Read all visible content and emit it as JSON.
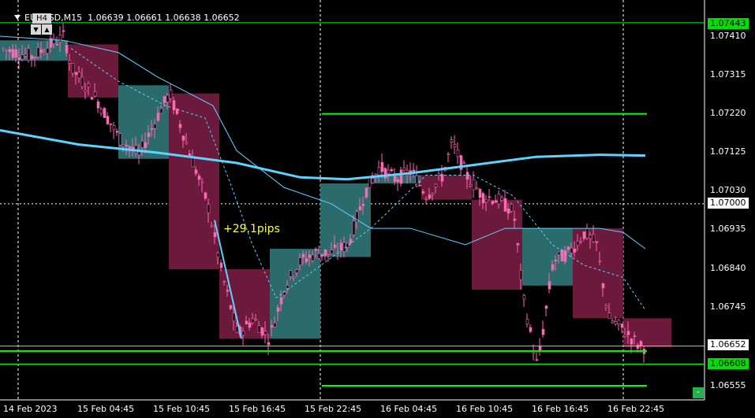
{
  "header": {
    "symbol": "EURUSD,M15",
    "open": "1.06639",
    "high": "1.06661",
    "low": "1.06638",
    "close": "1.06652"
  },
  "timeframe_box": "H4",
  "annotation": "+29.1pips",
  "colors": {
    "bull_candle": "#ff66b3",
    "bear_candle": "#ff66b3",
    "bull_box": "#2b6b6b",
    "bear_box": "#6b1a3c",
    "ma_long": "#5fd3ff",
    "ma_short": "#5fd3ff",
    "level_line": "#00ff00",
    "grid": "#ffffff"
  },
  "price_labels": [
    {
      "text": "1.07443",
      "type": "highlight"
    },
    {
      "text": "1.07410",
      "type": "tick"
    },
    {
      "text": "1.07315",
      "type": "tick"
    },
    {
      "text": "1.07220",
      "type": "tick"
    },
    {
      "text": "1.07125",
      "type": "tick"
    },
    {
      "text": "1.07030",
      "type": "tick"
    },
    {
      "text": "1.07000",
      "type": "crosshair"
    },
    {
      "text": "1.06935",
      "type": "tick"
    },
    {
      "text": "1.06840",
      "type": "tick"
    },
    {
      "text": "1.06745",
      "type": "tick"
    },
    {
      "text": "1.06652",
      "type": "current"
    },
    {
      "text": "1.06608",
      "type": "highlight"
    },
    {
      "text": "1.06555",
      "type": "tick"
    }
  ],
  "time_labels": [
    "14 Feb 2023",
    "15 Feb 04:45",
    "15 Feb 10:45",
    "15 Feb 16:45",
    "15 Feb 22:45",
    "16 Feb 04:45",
    "16 Feb 10:45",
    "16 Feb 16:45",
    "16 Feb 22:45"
  ],
  "chart_data": {
    "type": "candlestick",
    "ylim": [
      1.0651,
      1.0755
    ],
    "h4_boxes": [
      {
        "o": 1.0735,
        "c": 1.074,
        "dir": "up"
      },
      {
        "o": 1.0739,
        "c": 1.0726,
        "dir": "down"
      },
      {
        "o": 1.0711,
        "c": 1.0729,
        "dir": "up"
      },
      {
        "o": 1.0727,
        "c": 1.0684,
        "dir": "down"
      },
      {
        "o": 1.0684,
        "c": 1.0667,
        "dir": "down"
      },
      {
        "o": 1.0667,
        "c": 1.0689,
        "dir": "up"
      },
      {
        "o": 1.0687,
        "c": 1.0705,
        "dir": "up"
      },
      {
        "o": 1.0705,
        "c": 1.0707,
        "dir": "up"
      },
      {
        "o": 1.0707,
        "c": 1.0701,
        "dir": "down"
      },
      {
        "o": 1.0701,
        "c": 1.0679,
        "dir": "down"
      },
      {
        "o": 1.068,
        "c": 1.0694,
        "dir": "up"
      },
      {
        "o": 1.0694,
        "c": 1.0672,
        "dir": "down"
      },
      {
        "o": 1.0672,
        "c": 1.0665,
        "dir": "down"
      }
    ],
    "levels": [
      "1.07443",
      "1.06608",
      "1.06652"
    ]
  },
  "corner_button": "-"
}
